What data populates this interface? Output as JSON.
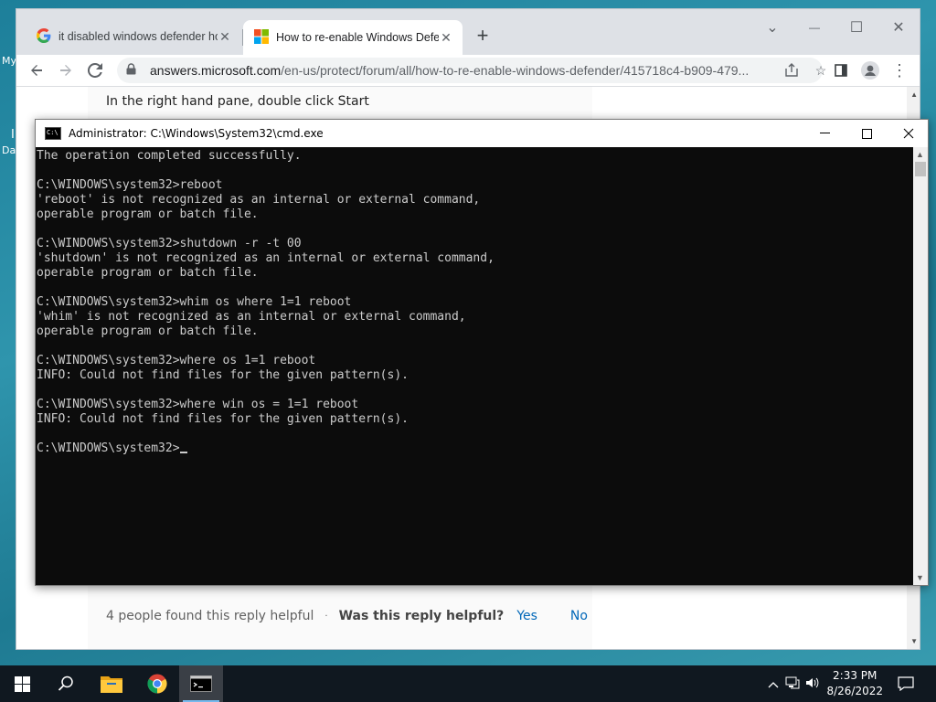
{
  "desktop": {
    "label_my": "My",
    "label_da": "Da",
    "label_i": "I"
  },
  "chrome": {
    "tabs": [
      {
        "title": "it disabled windows defender how",
        "icon": "google-g-icon",
        "active": false
      },
      {
        "title": "How to re-enable Windows Defe",
        "icon": "microsoft-logo-icon",
        "active": true
      }
    ],
    "new_tab": "+",
    "window_controls": {
      "dropdown": "⌄",
      "minimize": "—",
      "maximize": "☐",
      "close": "✕"
    },
    "address": {
      "host": "answers.microsoft.com",
      "path": "/en-us/protect/forum/all/how-to-re-enable-windows-defender/415718c4-b909-479..."
    }
  },
  "page": {
    "instruction": "In the right hand pane, double click Start",
    "helpful_count": "4 people found this reply helpful",
    "dot": "·",
    "question": "Was this reply helpful?",
    "yes": "Yes",
    "no": "No"
  },
  "cmd": {
    "title": "Administrator: C:\\Windows\\System32\\cmd.exe",
    "icon_glyph": "C:\\",
    "lines": [
      "The operation completed successfully.",
      "",
      "C:\\WINDOWS\\system32>reboot",
      "'reboot' is not recognized as an internal or external command,",
      "operable program or batch file.",
      "",
      "C:\\WINDOWS\\system32>shutdown -r -t 00",
      "'shutdown' is not recognized as an internal or external command,",
      "operable program or batch file.",
      "",
      "C:\\WINDOWS\\system32>whim os where 1=1 reboot",
      "'whim' is not recognized as an internal or external command,",
      "operable program or batch file.",
      "",
      "C:\\WINDOWS\\system32>where os 1=1 reboot",
      "INFO: Could not find files for the given pattern(s).",
      "",
      "C:\\WINDOWS\\system32>where win os = 1=1 reboot",
      "INFO: Could not find files for the given pattern(s).",
      "",
      "C:\\WINDOWS\\system32>"
    ]
  },
  "taskbar": {
    "time": "2:33 PM",
    "date": "8/26/2022",
    "accent": "#76b9ed"
  }
}
